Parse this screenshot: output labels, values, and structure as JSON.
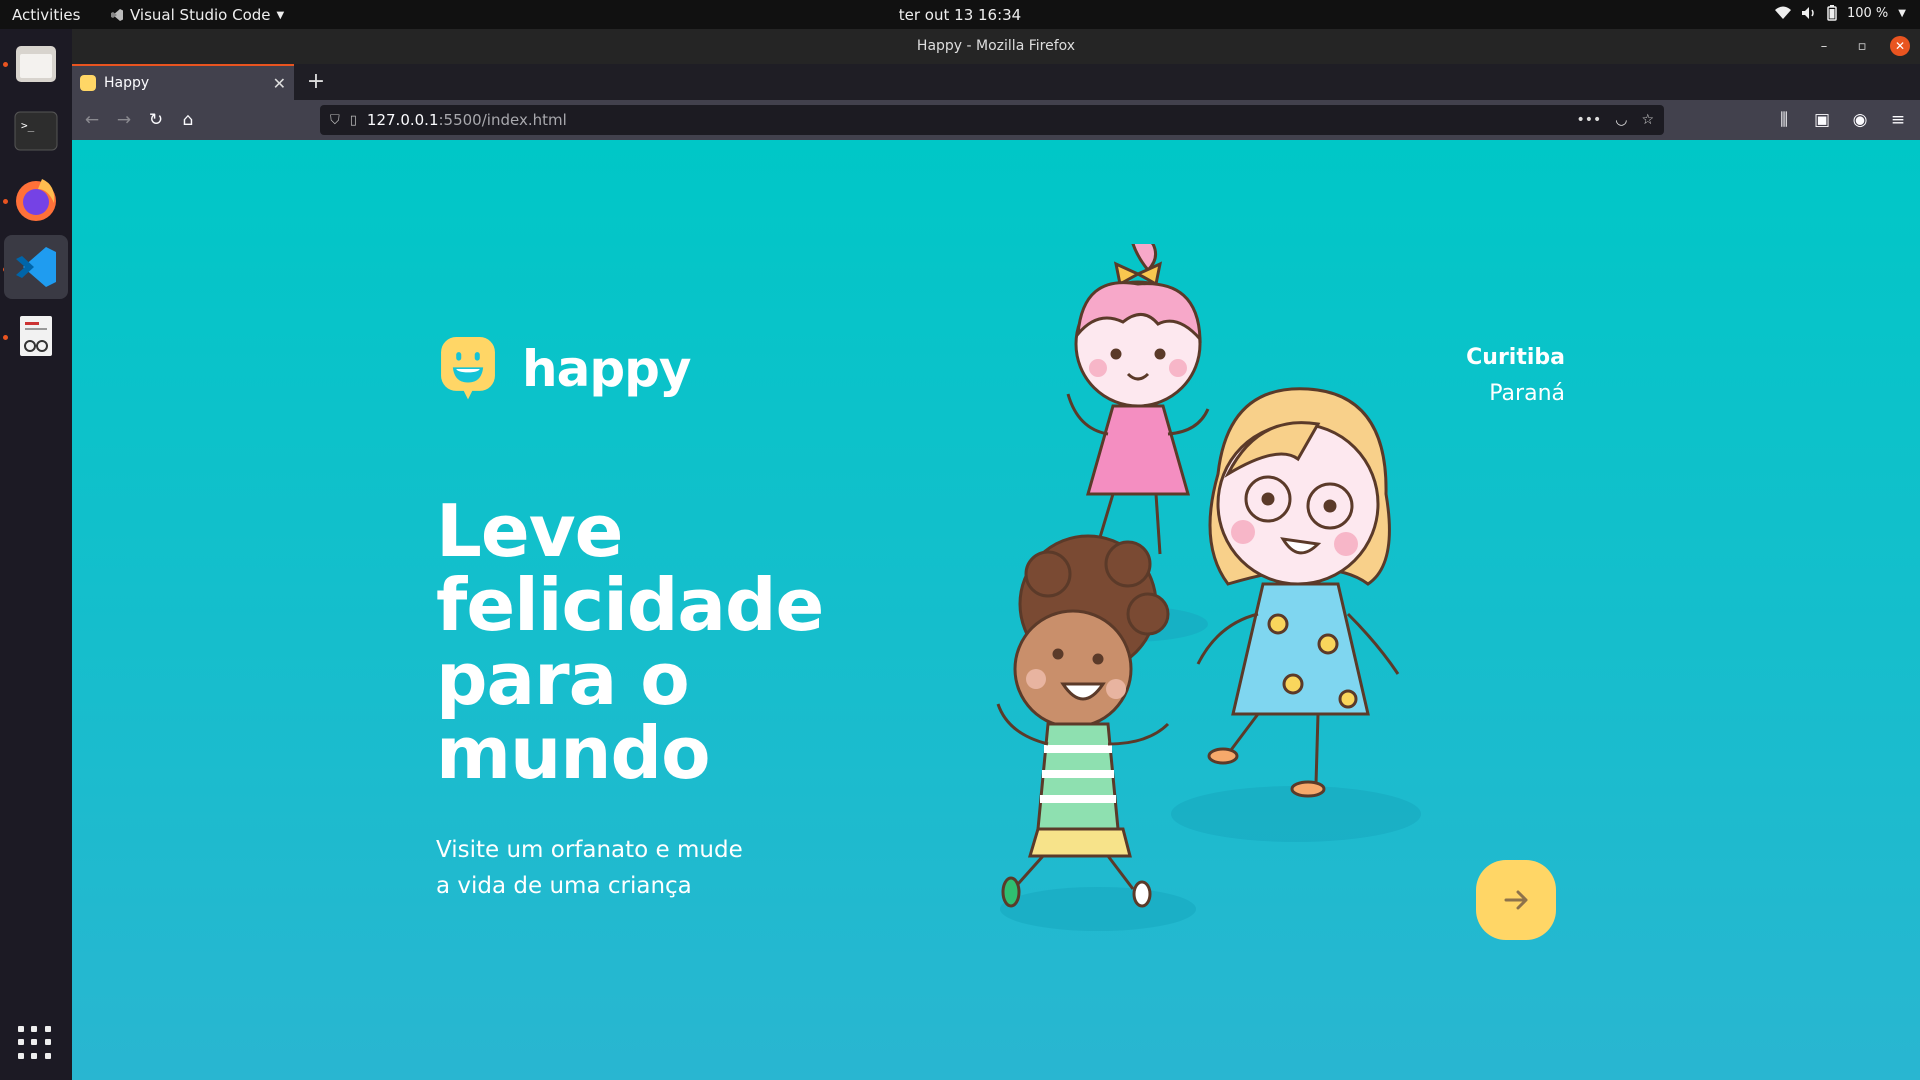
{
  "topbar": {
    "activities": "Activities",
    "app_name": "Visual Studio Code",
    "clock": "ter out 13  16:34",
    "battery": "100 %"
  },
  "dock": {
    "items": [
      {
        "name": "files",
        "icon": "folder-icon"
      },
      {
        "name": "terminal",
        "icon": "terminal-icon"
      },
      {
        "name": "firefox",
        "icon": "firefox-icon"
      },
      {
        "name": "vscode",
        "icon": "vscode-icon"
      },
      {
        "name": "reader",
        "icon": "document-viewer-icon"
      }
    ]
  },
  "window": {
    "title": "Happy - Mozilla Firefox"
  },
  "tab": {
    "title": "Happy"
  },
  "navbar": {
    "url_host": "127.0.0.1",
    "url_path": ":5500/index.html"
  },
  "page": {
    "brand": "happy",
    "location": {
      "city": "Curitiba",
      "state": "Paraná"
    },
    "headline": [
      "Leve",
      "felicidade",
      "para o",
      "mundo"
    ],
    "subtitle": [
      "Visite um orfanato e mude",
      "a vida de uma criança"
    ],
    "enter_icon": "arrow-right-icon"
  },
  "colors": {
    "accent_yellow": "#ffd666",
    "bg_top": "#00c7c7",
    "bg_bottom": "#29b6d1",
    "ubuntu_orange": "#e95420"
  }
}
